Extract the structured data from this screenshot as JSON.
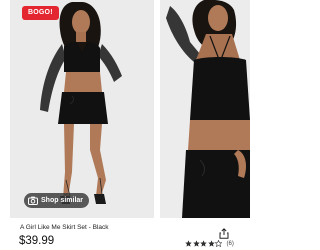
{
  "product": {
    "badge": "BOGO!",
    "shop_similar_label": "Shop similar",
    "title": "A Girl Like Me Skirt Set - Black",
    "price": "$39.99",
    "rating_value": 4,
    "rating_max": 5,
    "review_count": "(6)"
  },
  "colors": {
    "badge_bg": "#e3262f",
    "star": "#2e2e2e",
    "outfit": "#111111",
    "skin": "#b07a58"
  },
  "icons": {
    "camera": "camera-icon",
    "share": "share-icon",
    "star": "star-icon"
  }
}
